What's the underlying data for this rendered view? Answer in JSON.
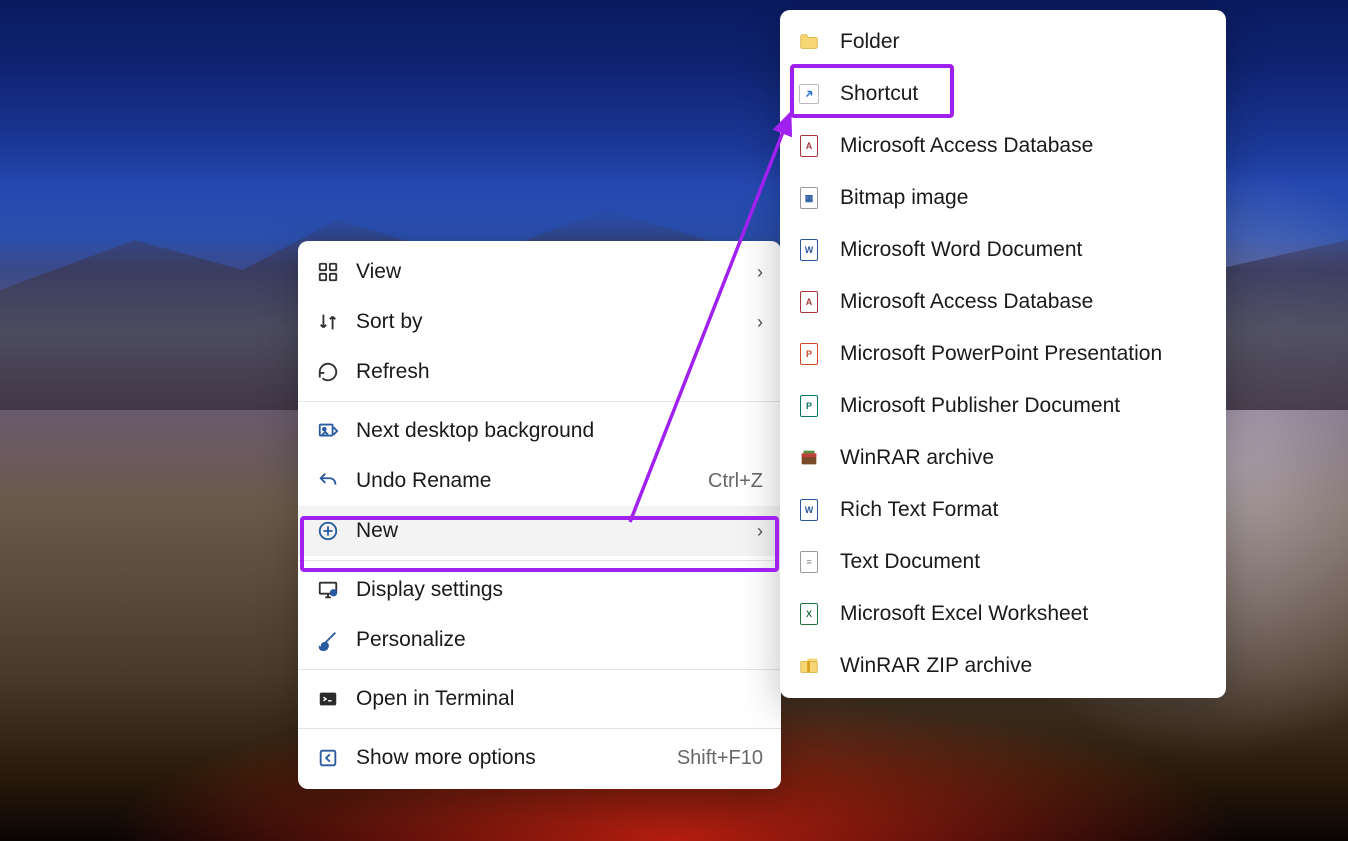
{
  "context_menu": {
    "items": [
      {
        "label": "View",
        "has_submenu": true
      },
      {
        "label": "Sort by",
        "has_submenu": true
      },
      {
        "label": "Refresh"
      },
      {
        "label": "Next desktop background"
      },
      {
        "label": "Undo Rename",
        "shortcut": "Ctrl+Z"
      },
      {
        "label": "New",
        "has_submenu": true,
        "hovered": true,
        "highlighted": true
      },
      {
        "label": "Display settings"
      },
      {
        "label": "Personalize"
      },
      {
        "label": "Open in Terminal"
      },
      {
        "label": "Show more options",
        "shortcut": "Shift+F10"
      }
    ]
  },
  "new_submenu": {
    "items": [
      {
        "label": "Folder"
      },
      {
        "label": "Shortcut",
        "highlighted": true
      },
      {
        "label": "Microsoft Access Database"
      },
      {
        "label": "Bitmap image"
      },
      {
        "label": "Microsoft Word Document"
      },
      {
        "label": "Microsoft Access Database"
      },
      {
        "label": "Microsoft PowerPoint Presentation"
      },
      {
        "label": "Microsoft Publisher Document"
      },
      {
        "label": "WinRAR archive"
      },
      {
        "label": "Rich Text Format"
      },
      {
        "label": "Text Document"
      },
      {
        "label": "Microsoft Excel Worksheet"
      },
      {
        "label": "WinRAR ZIP archive"
      }
    ]
  },
  "annotation": {
    "color": "#a020f0"
  }
}
